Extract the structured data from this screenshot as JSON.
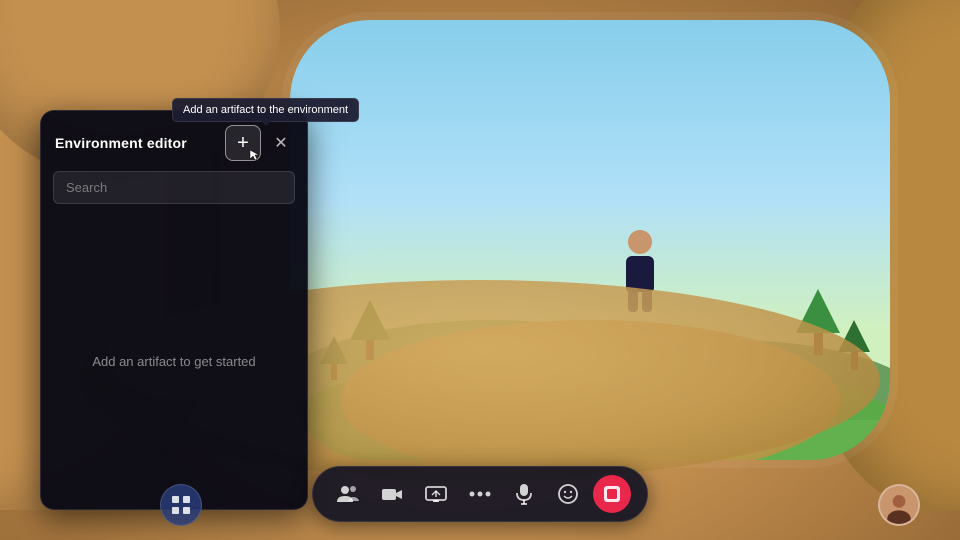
{
  "scene": {
    "background_color": "#c49050"
  },
  "tooltip": {
    "text": "Add an artifact to the environment"
  },
  "panel": {
    "title": "Environment editor",
    "add_button_label": "+",
    "close_button_label": "✕",
    "search_placeholder": "Search",
    "empty_message": "Add an artifact to get started"
  },
  "toolbar": {
    "buttons": [
      {
        "id": "people",
        "icon": "👥",
        "label": "People"
      },
      {
        "id": "camera",
        "icon": "🎬",
        "label": "Camera"
      },
      {
        "id": "screen",
        "icon": "🖥",
        "label": "Screen share"
      },
      {
        "id": "more",
        "icon": "···",
        "label": "More"
      },
      {
        "id": "mic",
        "icon": "🎤",
        "label": "Microphone"
      },
      {
        "id": "emoji",
        "icon": "😊",
        "label": "Emoji"
      },
      {
        "id": "artifact",
        "icon": "⬛",
        "label": "Artifact",
        "active": true
      }
    ],
    "grid_button_label": "⊞",
    "user_avatar_label": "User avatar"
  },
  "colors": {
    "accent_red": "#e8274a",
    "panel_bg": "rgba(8,8,20,0.96)",
    "toolbar_bg": "rgba(20,20,35,0.92)"
  }
}
